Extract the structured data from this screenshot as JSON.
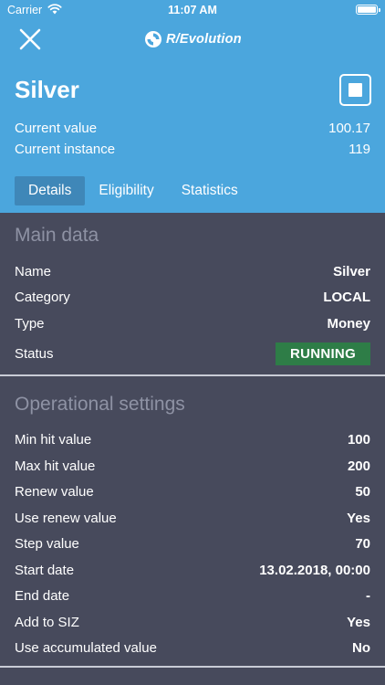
{
  "status_bar": {
    "carrier": "Carrier",
    "time": "11:07 AM"
  },
  "brand": {
    "name": "R/Evolution"
  },
  "header": {
    "title": "Silver",
    "current_value_label": "Current value",
    "current_value": "100.17",
    "current_instance_label": "Current instance",
    "current_instance": "119"
  },
  "tabs": [
    {
      "label": "Details",
      "active": true
    },
    {
      "label": "Eligibility",
      "active": false
    },
    {
      "label": "Statistics",
      "active": false
    }
  ],
  "main_data": {
    "title": "Main data",
    "rows": [
      {
        "label": "Name",
        "value": "Silver"
      },
      {
        "label": "Category",
        "value": "LOCAL"
      },
      {
        "label": "Type",
        "value": "Money"
      }
    ],
    "status_label": "Status",
    "status_value": "RUNNING"
  },
  "operational": {
    "title": "Operational settings",
    "rows": [
      {
        "label": "Min hit value",
        "value": "100"
      },
      {
        "label": "Max hit value",
        "value": "200"
      },
      {
        "label": "Renew value",
        "value": "50"
      },
      {
        "label": "Use renew value",
        "value": "Yes"
      },
      {
        "label": "Step value",
        "value": "70"
      },
      {
        "label": "Start date",
        "value": "13.02.2018, 00:00"
      },
      {
        "label": "End date",
        "value": "-"
      },
      {
        "label": "Add to SIZ",
        "value": "Yes"
      },
      {
        "label": "Use accumulated value",
        "value": "No"
      }
    ]
  },
  "colors": {
    "header_bg": "#4ba6dd",
    "body_bg": "#474a5c",
    "status_running": "#2e7d47",
    "active_tab": "#3f87b8"
  },
  "icons": {
    "close": "close-icon",
    "stop": "stop-icon",
    "logo": "revolution-logo-icon",
    "wifi": "wifi-icon",
    "battery": "battery-icon"
  }
}
